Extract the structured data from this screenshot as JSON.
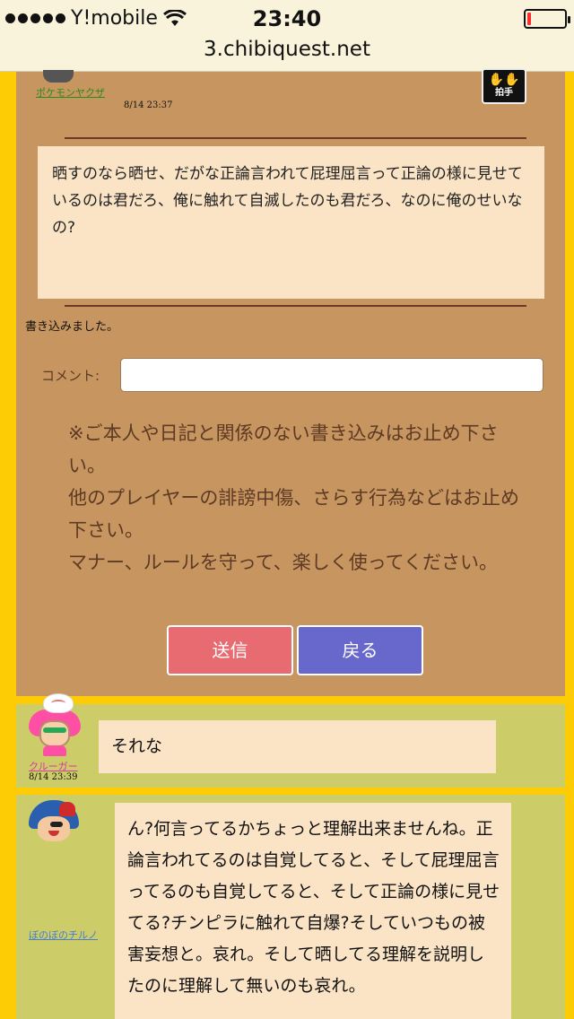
{
  "status_bar": {
    "carrier": "Y!mobile",
    "time": "23:40",
    "url": "3.chibiquest.net",
    "battery_level": 0.1,
    "battery_color": "#ff2d2d"
  },
  "post": {
    "username": "ポケモンヤクザ",
    "date": "8/14 23:37",
    "clap_label": "拍手",
    "body": "晒すのなら晒せ、だがな正論言われて屁理屈言って正論の様に見せているのは君だろ、俺に触れて自滅したのも君だろ、なのに俺のせいなの?"
  },
  "status_message": "書き込みました。",
  "comment_form": {
    "label": "コメント:",
    "value": "",
    "placeholder": ""
  },
  "notice": {
    "line1": "※ご本人や日記と関係のない書き込みはお止め下さい。",
    "line2": "他のプレイヤーの誹謗中傷、さらす行為などはお止め下さい。",
    "line3": "マナー、ルールを守って、楽しく使ってください。"
  },
  "buttons": {
    "send": "送信",
    "back": "戻る"
  },
  "comments": [
    {
      "username": "クルーガー",
      "date": "8/14 23:39",
      "text": "それな"
    },
    {
      "username": "ぼのぼのチルノ",
      "text": "ん?何言ってるかちょっと理解出来ませんね。正論言われてるのは自覚してると、そして屁理屈言ってるのも自覚してると、そして正論の様に見せてる?チンピラに触れて自爆?そしていつもの被害妄想と。哀れ。そして晒してる理解を説明したのに理解して無いのも哀れ。"
    }
  ],
  "colors": {
    "page_background": "#fdcc05",
    "panel_background": "#c7955f",
    "comment_row_background": "#cccc68",
    "bubble_background": "#fbe4c6",
    "send_button": "#e96b72",
    "back_button": "#6767cc"
  }
}
